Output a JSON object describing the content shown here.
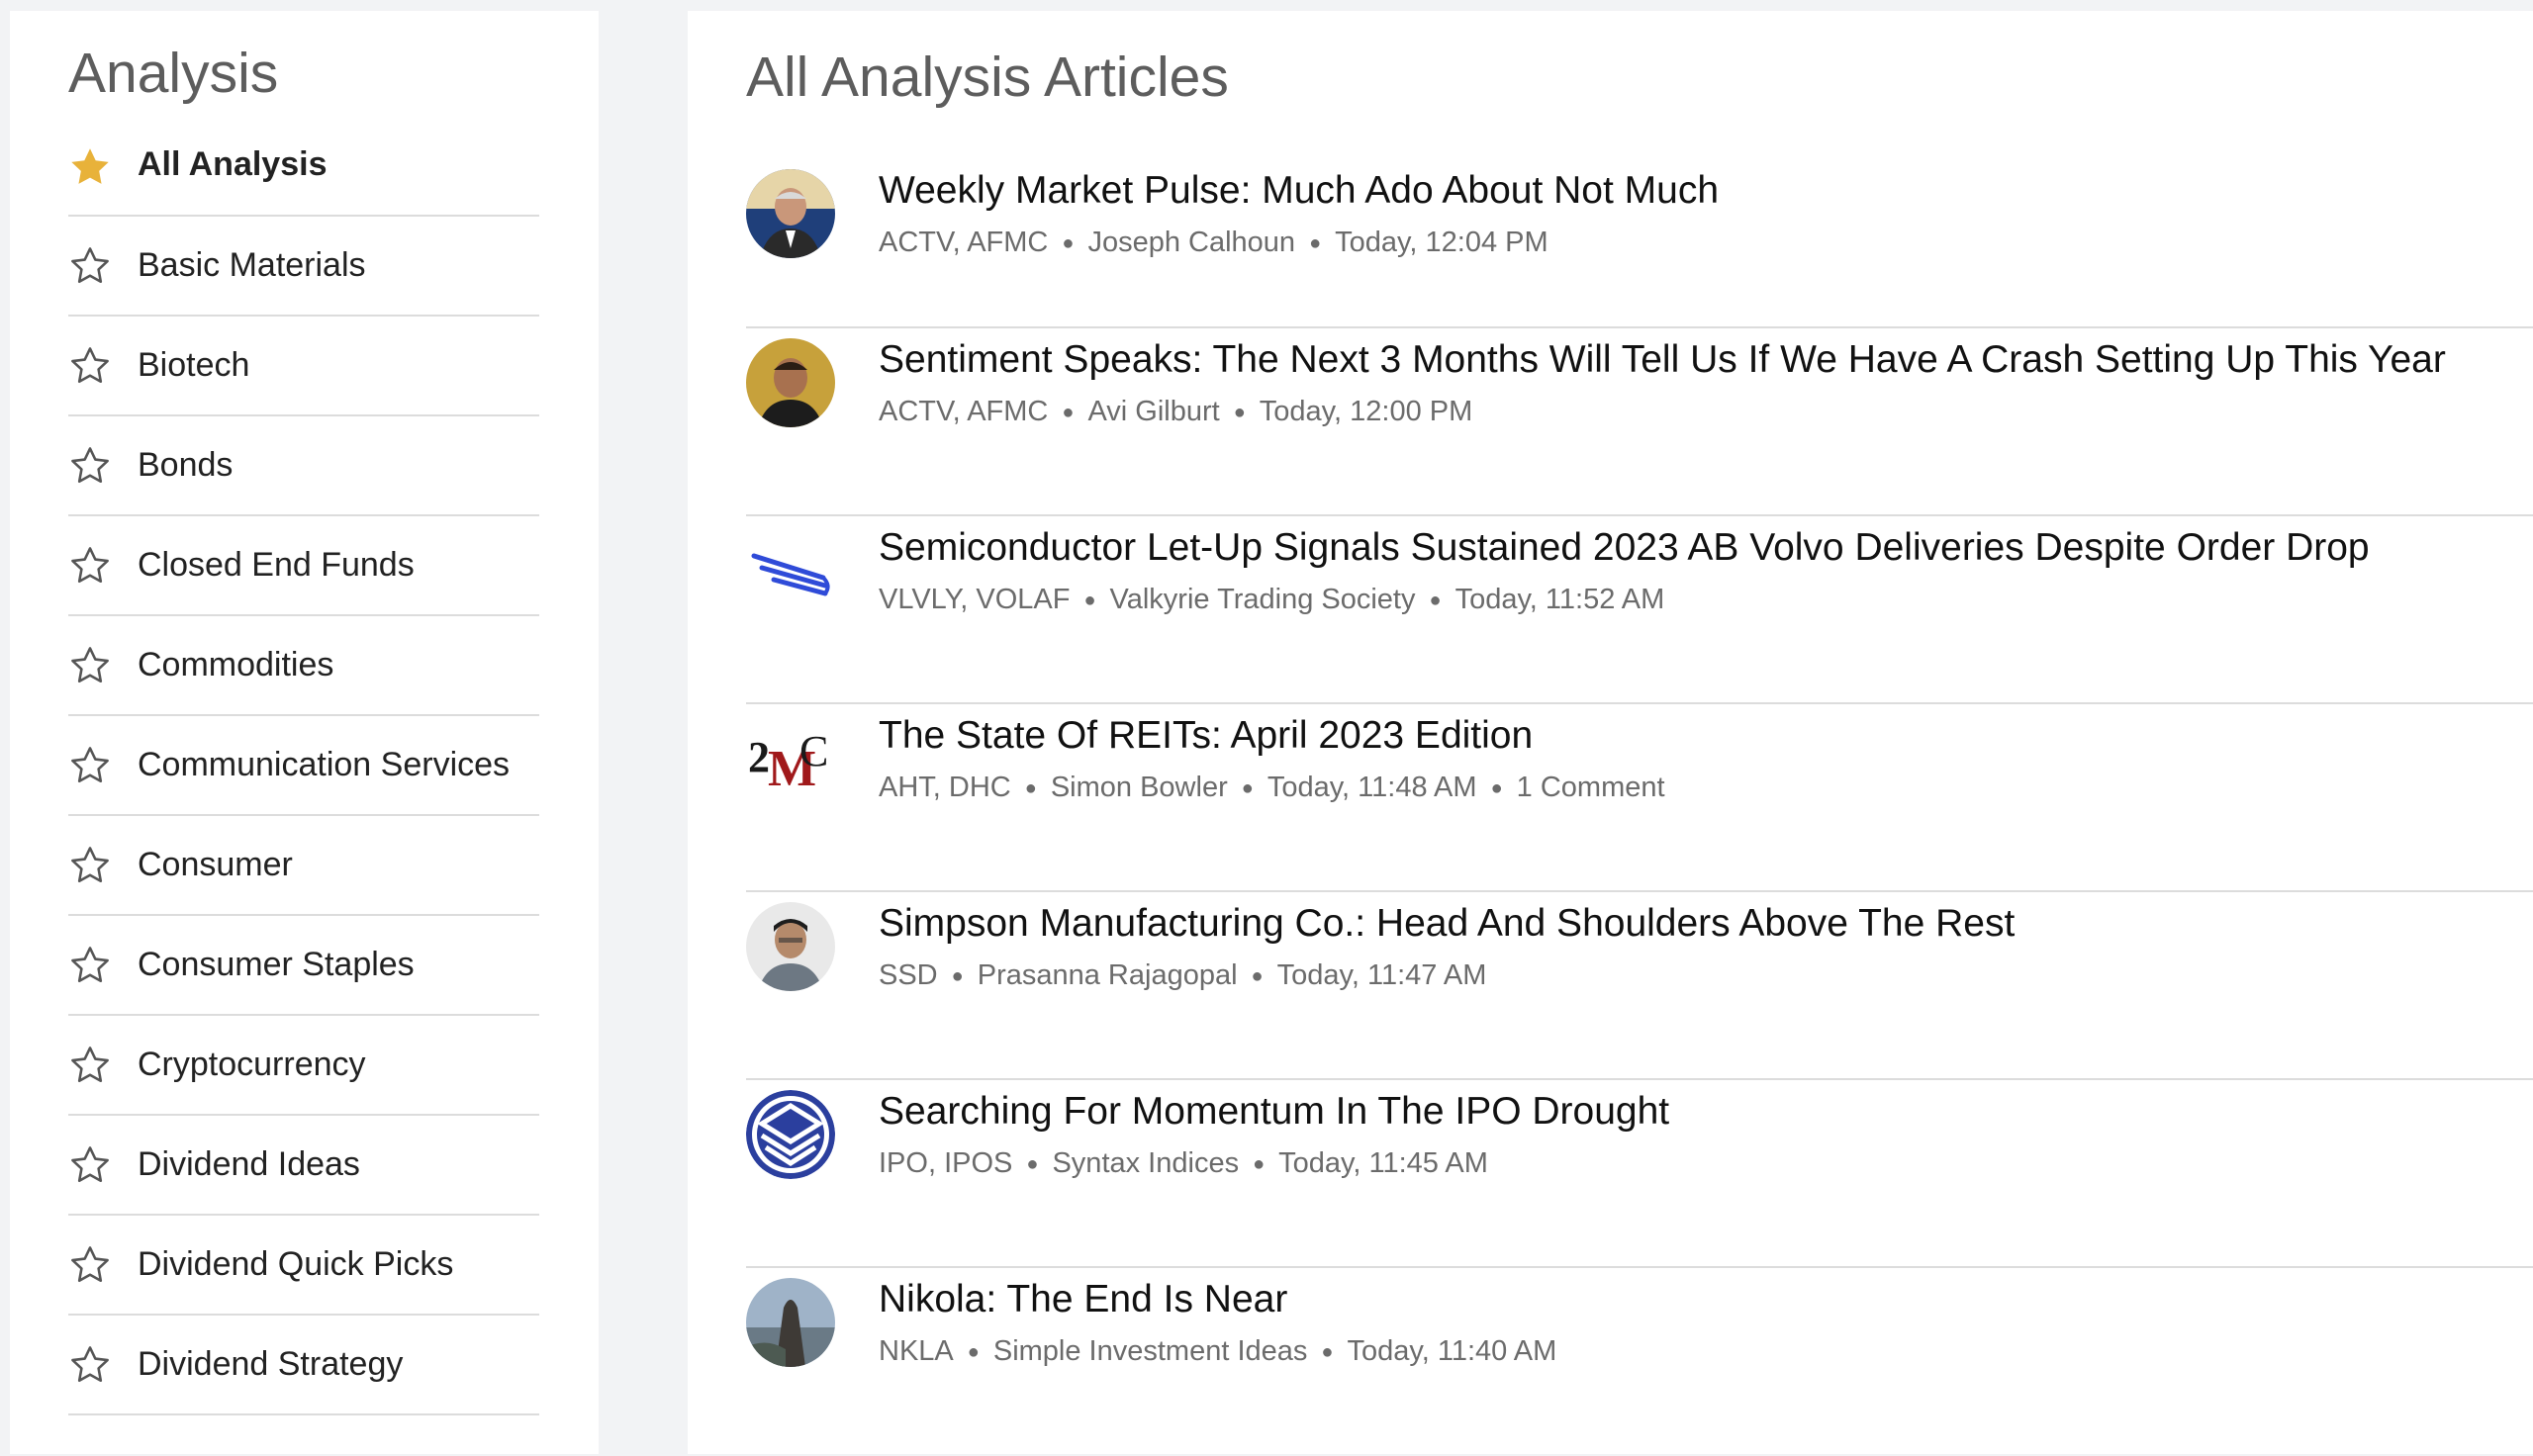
{
  "sidebar": {
    "title": "Analysis",
    "items": [
      {
        "label": "All Analysis",
        "active": true
      },
      {
        "label": "Basic Materials"
      },
      {
        "label": "Biotech"
      },
      {
        "label": "Bonds"
      },
      {
        "label": "Closed End Funds"
      },
      {
        "label": "Commodities"
      },
      {
        "label": "Communication Services"
      },
      {
        "label": "Consumer"
      },
      {
        "label": "Consumer Staples"
      },
      {
        "label": "Cryptocurrency"
      },
      {
        "label": "Dividend Ideas"
      },
      {
        "label": "Dividend Quick Picks"
      },
      {
        "label": "Dividend Strategy"
      }
    ]
  },
  "main": {
    "title": "All Analysis Articles",
    "articles": [
      {
        "title": "Weekly Market Pulse: Much Ado About Not Much",
        "tickers": "ACTV, AFMC",
        "author": "Joseph Calhoun",
        "time": "Today, 12:04 PM",
        "avatar": "person-avatar"
      },
      {
        "title": "Sentiment Speaks: The Next 3 Months Will Tell Us If We Have A Crash Setting Up This Year",
        "tickers": "ACTV, AFMC",
        "author": "Avi Gilburt",
        "time": "Today, 12:00 PM",
        "avatar": "person-avatar"
      },
      {
        "title": "Semiconductor Let-Up Signals Sustained 2023 AB Volvo Deliveries Despite Order Drop",
        "tickers": "VLVLY, VOLAF",
        "author": "Valkyrie Trading Society",
        "time": "Today, 11:52 AM",
        "avatar": "wing-logo"
      },
      {
        "title": "The State Of REITs: April 2023 Edition",
        "tickers": "AHT, DHC",
        "author": "Simon Bowler",
        "time": "Today, 11:48 AM",
        "comments": "1 Comment",
        "avatar": "2mc-logo"
      },
      {
        "title": "Simpson Manufacturing Co.: Head And Shoulders Above The Rest",
        "tickers": "SSD",
        "author": "Prasanna Rajagopal",
        "time": "Today, 11:47 AM",
        "avatar": "person-avatar"
      },
      {
        "title": "Searching For Momentum In The IPO Drought",
        "tickers": "IPO, IPOS",
        "author": "Syntax Indices",
        "time": "Today, 11:45 AM",
        "avatar": "syntax-logo"
      },
      {
        "title": "Nikola: The End Is Near",
        "tickers": "NKLA",
        "author": "Simple Investment Ideas",
        "time": "Today, 11:40 AM",
        "avatar": "landscape-avatar"
      }
    ]
  },
  "colors": {
    "star_active": "#e8b23a",
    "star_outline": "#555555",
    "title_gray": "#5d5d5d",
    "meta_gray": "#6b6b6b"
  }
}
